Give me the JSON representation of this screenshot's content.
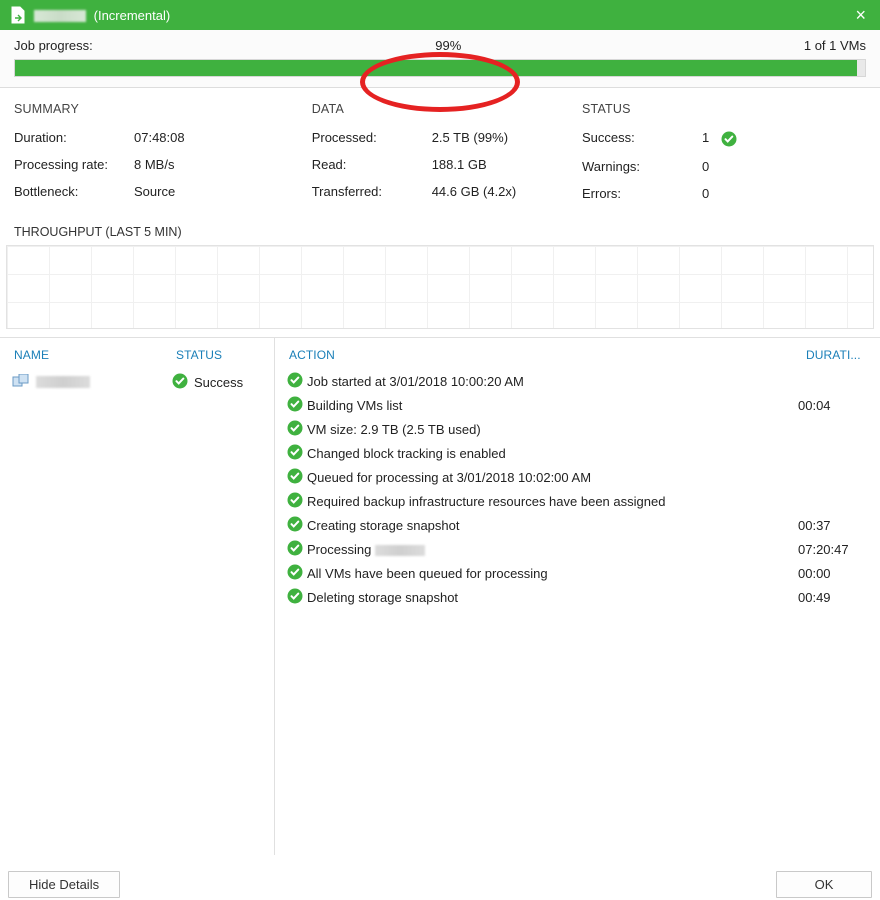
{
  "titlebar": {
    "mode": "(Incremental)"
  },
  "progress": {
    "label": "Job progress:",
    "percent_text": "99%",
    "percent_value": 99,
    "vms_text": "1 of 1 VMs"
  },
  "summary": {
    "heading": "SUMMARY",
    "duration_label": "Duration:",
    "duration_value": "07:48:08",
    "rate_label": "Processing rate:",
    "rate_value": "8 MB/s",
    "bottleneck_label": "Bottleneck:",
    "bottleneck_value": "Source"
  },
  "data": {
    "heading": "DATA",
    "processed_label": "Processed:",
    "processed_value": "2.5 TB (99%)",
    "read_label": "Read:",
    "read_value": "188.1 GB",
    "transferred_label": "Transferred:",
    "transferred_value": "44.6 GB (4.2x)"
  },
  "status": {
    "heading": "STATUS",
    "success_label": "Success:",
    "success_value": "1",
    "warnings_label": "Warnings:",
    "warnings_value": "0",
    "errors_label": "Errors:",
    "errors_value": "0"
  },
  "throughput_heading": "THROUGHPUT (LAST 5 MIN)",
  "columns": {
    "name": "NAME",
    "status": "STATUS",
    "action": "ACTION",
    "duration": "DURATI..."
  },
  "vm": {
    "status_text": "Success"
  },
  "actions": [
    {
      "text": "Job started at 3/01/2018 10:00:20 AM",
      "duration": ""
    },
    {
      "text": "Building VMs list",
      "duration": "00:04"
    },
    {
      "text": "VM size: 2.9 TB (2.5 TB used)",
      "duration": ""
    },
    {
      "text": "Changed block tracking is enabled",
      "duration": ""
    },
    {
      "text": "Queued for processing at 3/01/2018 10:02:00 AM",
      "duration": ""
    },
    {
      "text": "Required backup infrastructure resources have been assigned",
      "duration": ""
    },
    {
      "text": "Creating storage snapshot",
      "duration": "00:37"
    },
    {
      "text": "Processing ",
      "duration": "07:20:47",
      "blurred_suffix": true
    },
    {
      "text": "All VMs have been queued for processing",
      "duration": "00:00"
    },
    {
      "text": "Deleting storage snapshot",
      "duration": "00:49"
    }
  ],
  "buttons": {
    "hide_details": "Hide Details",
    "ok": "OK"
  },
  "colors": {
    "green": "#3fb13f",
    "link": "#1a7fb8",
    "highlight_red": "#e52222"
  }
}
